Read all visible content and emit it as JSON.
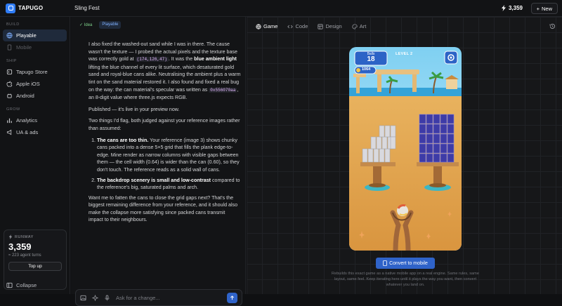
{
  "app": {
    "brand": "TAPUGO",
    "project": "Sling Fest",
    "credits": "3,359",
    "new_label": "New"
  },
  "sidebar": {
    "sections": [
      {
        "title": "BUILD",
        "items": [
          {
            "label": "Playable",
            "icon": "globe-icon",
            "active": true
          },
          {
            "label": "Mobile",
            "icon": "mobile-icon",
            "disabled": true
          }
        ]
      },
      {
        "title": "SHIP",
        "items": [
          {
            "label": "Tapugo Store",
            "icon": "store-icon"
          },
          {
            "label": "Apple iOS",
            "icon": "apple-icon"
          },
          {
            "label": "Android",
            "icon": "android-icon"
          }
        ]
      },
      {
        "title": "GROW",
        "items": [
          {
            "label": "Analytics",
            "icon": "analytics-icon"
          },
          {
            "label": "UA & ads",
            "icon": "ads-icon"
          }
        ]
      }
    ],
    "runway": {
      "label": "RUNWAY",
      "value": "3,359",
      "sub": "≈ 223 agent turns",
      "topup": "Top up"
    },
    "collapse": "Collapse"
  },
  "chat": {
    "tags": {
      "idea": "✓ Idea",
      "playable": "Playable"
    },
    "p1_a": "I also fixed the washed-out sand while I was in there. The cause wasn't the texture — I probed the actual pixels and the texture base was correctly gold at ",
    "p1_code1": "(174,126,47)",
    "p1_b": ". It was the ",
    "p1_bold": "blue ambient light",
    "p1_c": " lifting the blue channel of every lit surface, which desaturated gold sand and royal-blue cans alike. Neutralising the ambient plus a warm tint on the sand material restored it. I also found and fixed a real bug on the way: the can material's specular was written as ",
    "p1_code2": "0x556070aa",
    "p1_d": ", an 8-digit value where three.js expects RGB.",
    "p2": "Published — it's live in your preview now.",
    "p3": "Two things I'd flag, both judged against your reference images rather than assumed:",
    "li1_bold": "The cans are too thin.",
    "li1": " Your reference (image 3) shows chunky cans packed into a dense 5×5 grid that fills the plank edge-to-edge. Mine render as narrow columns with visible gaps between them — the cell width (0.64) is wider than the can (0.60), so they don't touch. The reference reads as a solid wall of cans.",
    "li2_bold": "The backdrop scenery is small and low-contrast",
    "li2": " compared to the reference's big, saturated palms and arch.",
    "p4": "Want me to fatten the cans to close the grid gaps next? That's the biggest remaining difference from your reference, and it should also make the collapse more satisfying since packed cans transmit impact to their neighbours.",
    "placeholder": "Ask for a change..."
  },
  "preview": {
    "tabs": [
      {
        "label": "Game",
        "icon": "globe-icon"
      },
      {
        "label": "Code",
        "icon": "code-icon"
      },
      {
        "label": "Design",
        "icon": "design-icon"
      },
      {
        "label": "Art",
        "icon": "palette-icon"
      }
    ],
    "game": {
      "balls_label": "Balls",
      "balls": "18",
      "coins": "1064",
      "level": "LEVEL 2"
    },
    "convert": "Convert to mobile",
    "desc": "Rebuilds this exact game as a native mobile app on a real engine. Same rules, same layout, same feel. Keep iterating here until it plays the way you want, then convert whatever you land on."
  },
  "colors": {
    "accent": "#2f63c9",
    "brand": "#2f7cf6",
    "sand": "#e1a24c",
    "sky": "#7fd0f2",
    "can_blue": "#3e3ba6",
    "hud_blue": "#2c63c6"
  }
}
